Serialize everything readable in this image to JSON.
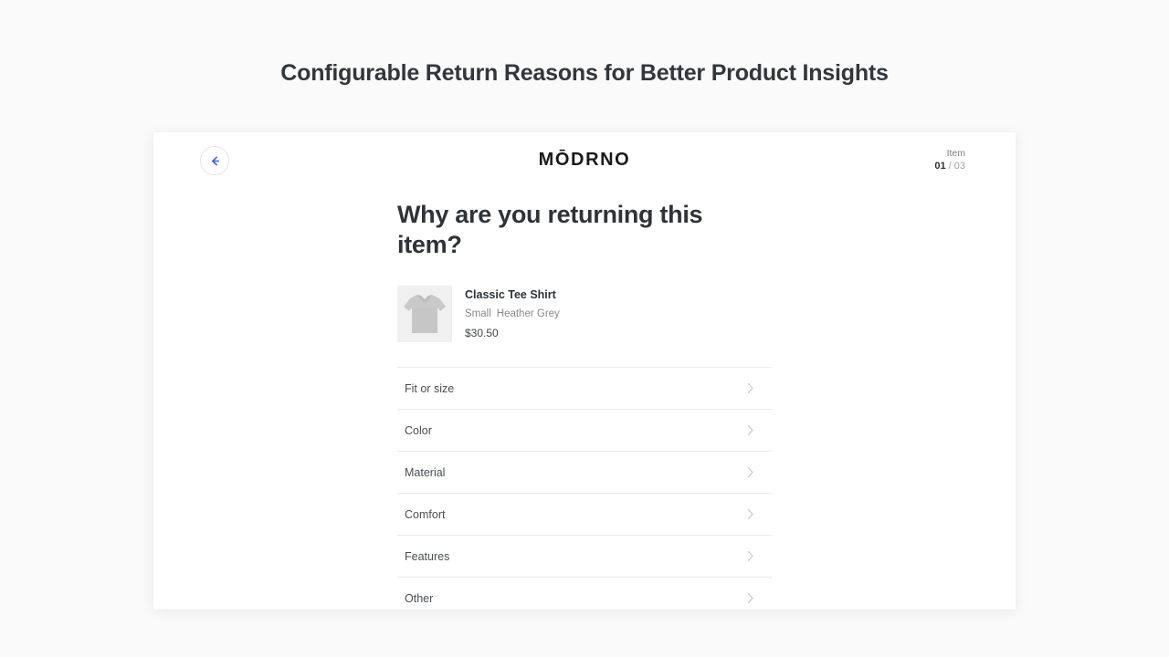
{
  "page": {
    "title": "Configurable Return Reasons for Better Product Insights",
    "background_color": "#fafafa"
  },
  "card": {
    "background_color": "#ffffff",
    "topbar": {
      "back_button": {
        "icon": "arrow-left-icon",
        "color": "#3d5afe"
      },
      "brand_logo": "MŌDRNO",
      "item_counter": {
        "label": "Item",
        "current": "01",
        "separator": " / ",
        "total": "03"
      }
    },
    "content": {
      "question": "Why are you returning this item?",
      "product": {
        "thumbnail_icon": "tee-shirt-image",
        "name": "Classic Tee Shirt",
        "size": "Small",
        "color": "Heather Grey",
        "price": "$30.50"
      },
      "reasons": [
        {
          "label": "Fit or size",
          "chevron": "chevron-right-icon"
        },
        {
          "label": "Color",
          "chevron": "chevron-right-icon"
        },
        {
          "label": "Material",
          "chevron": "chevron-right-icon"
        },
        {
          "label": "Comfort",
          "chevron": "chevron-right-icon"
        },
        {
          "label": "Features",
          "chevron": "chevron-right-icon"
        },
        {
          "label": "Other",
          "chevron": "chevron-right-icon"
        }
      ]
    }
  }
}
